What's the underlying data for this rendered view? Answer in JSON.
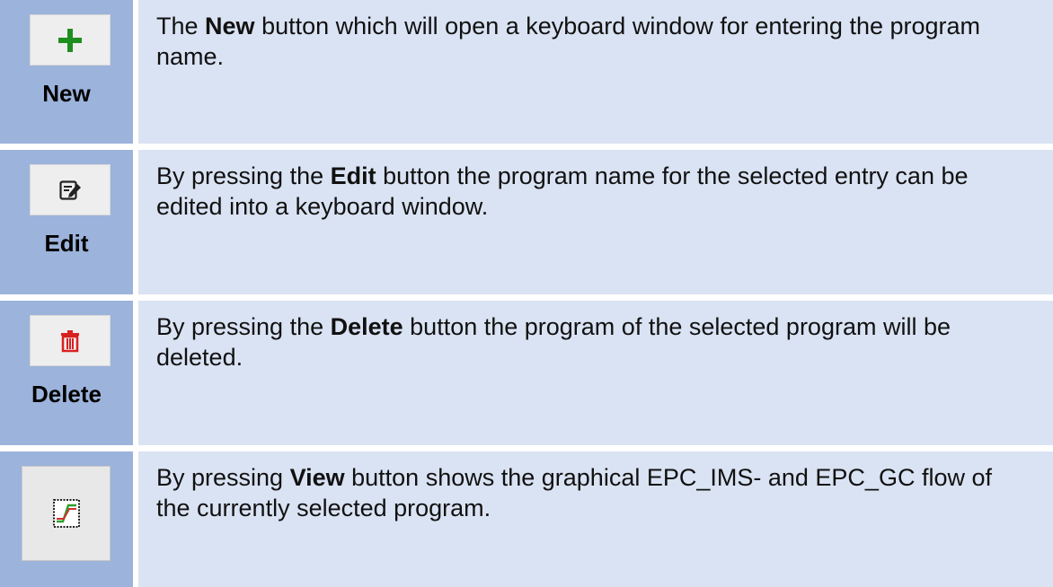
{
  "rows": [
    {
      "icon": "plus-icon",
      "label": "New",
      "pre": "The ",
      "bold": "New",
      "post": " button which will open a keyboard window for entering the program name."
    },
    {
      "icon": "edit-icon",
      "label": "Edit",
      "pre": "By pressing the ",
      "bold": "Edit",
      "post": " button the program name for the selected entry can be edited into a keyboard window."
    },
    {
      "icon": "trash-icon",
      "label": "Delete",
      "pre": "By pressing the ",
      "bold": "Delete",
      "post": " button the program of the selected program will be deleted."
    },
    {
      "icon": "graph-icon",
      "label": "",
      "pre": "By pressing ",
      "bold": "View",
      "post": " button shows the graphical EPC_IMS- and EPC_GC flow of the currently selected program."
    }
  ],
  "colors": {
    "icon_cell": "#9cb3dc",
    "desc_cell": "#dae3f3",
    "plus": "#1e8f1e",
    "trash": "#d92020",
    "graph_green": "#2e9e2e",
    "graph_red": "#d03030"
  }
}
